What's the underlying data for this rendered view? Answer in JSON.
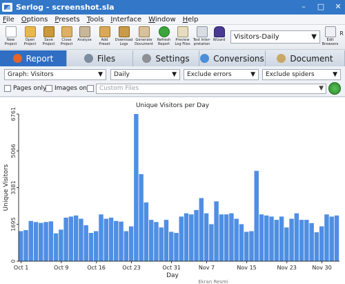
{
  "window": {
    "title": "Serlog - screenshot.sla",
    "controls": [
      "–",
      "□",
      "✕"
    ]
  },
  "menu": [
    {
      "label": "File",
      "access": "F",
      "rest": "ile"
    },
    {
      "label": "Options",
      "access": "O",
      "rest": "ptions"
    },
    {
      "label": "Presets",
      "access": "P",
      "rest": "resets"
    },
    {
      "label": "Tools",
      "access": "T",
      "rest": "ools"
    },
    {
      "label": "Interface",
      "access": "I",
      "rest": "nterface"
    },
    {
      "label": "Window",
      "access": "W",
      "rest": "indow"
    },
    {
      "label": "Help",
      "access": "H",
      "rest": "elp"
    }
  ],
  "toolbar": {
    "buttons": [
      {
        "line1": "New",
        "line2": "Project",
        "icon": "new-project-icon",
        "kind": "doc"
      },
      {
        "line1": "Open",
        "line2": "Project",
        "icon": "open-project-icon",
        "kind": "open"
      },
      {
        "line1": "Save",
        "line2": "Project",
        "icon": "save-project-icon",
        "kind": "save"
      },
      {
        "line1": "Close",
        "line2": "Project",
        "icon": "close-project-icon",
        "kind": "close"
      },
      {
        "line1": "Analyze",
        "line2": "",
        "icon": "analyze-icon",
        "kind": "analyze"
      },
      {
        "line1": "Add",
        "line2": "Preset",
        "icon": "add-preset-icon",
        "kind": "add"
      },
      {
        "line1": "Download",
        "line2": "Logs",
        "icon": "download-logs-icon",
        "kind": "download"
      },
      {
        "line1": "Generate",
        "line2": "Document",
        "icon": "generate-document-icon",
        "kind": "gen"
      },
      {
        "line1": "Refresh",
        "line2": "Report",
        "icon": "refresh-report-icon",
        "kind": "refresh"
      },
      {
        "line1": "Preview",
        "line2": "Log Files",
        "icon": "preview-log-files-icon",
        "kind": "preview"
      },
      {
        "line1": "Test Inter-",
        "line2": "pretation",
        "icon": "test-interpretation-icon",
        "kind": "test"
      },
      {
        "line1": "Wizard",
        "line2": "",
        "icon": "wizard-icon",
        "kind": "wizard"
      }
    ],
    "preset_value": "Visitors-Daily",
    "edit_button": {
      "line1": "Edit",
      "line2": "Browsers",
      "icon": "edit-browsers-icon"
    },
    "extra_label": "R"
  },
  "tabs": [
    {
      "label": "Report",
      "icon": "report-icon",
      "active": true,
      "color": "#e0662b"
    },
    {
      "label": "Files",
      "icon": "files-icon",
      "active": false,
      "color": "#7d8c9e"
    },
    {
      "label": "Settings",
      "icon": "settings-icon",
      "active": false,
      "color": "#8d9096"
    },
    {
      "label": "Conversions",
      "icon": "conversions-icon",
      "active": false,
      "color": "#4a8fd8"
    },
    {
      "label": "Document",
      "icon": "document-icon",
      "active": false,
      "color": "#c9a866"
    }
  ],
  "filters": {
    "graph": "Graph: Visitors",
    "period": "Daily",
    "errors": "Exclude errors",
    "spiders": "Exclude spiders",
    "pages_only": "Pages only",
    "images_only": "Images only",
    "custom_files_placeholder": "Custom Files"
  },
  "colors": {
    "accent": "#2f6ec3",
    "bar": "#4f8fe3"
  },
  "chart_data": {
    "type": "bar",
    "title": "Unique Visitors per Day",
    "xlabel": "Day",
    "ylabel": "Unique Visitors",
    "ylim": [
      0,
      6761
    ],
    "yticks": [
      0,
      1695,
      3381,
      5066,
      6761
    ],
    "xtick_labels": [
      "Oct 1",
      "Oct 9",
      "Oct 16",
      "Oct 23",
      "Oct 31",
      "Nov 7",
      "Nov 15",
      "Nov 23",
      "Nov 30"
    ],
    "xtick_indices": [
      1,
      9,
      16,
      23,
      31,
      38,
      46,
      54,
      61
    ],
    "grid": false,
    "values": [
      1380,
      1430,
      1850,
      1800,
      1760,
      1800,
      1830,
      1280,
      1450,
      2000,
      2050,
      2100,
      1950,
      1650,
      1300,
      1380,
      2150,
      1950,
      2000,
      1850,
      1820,
      1380,
      1600,
      6761,
      4000,
      2700,
      1900,
      1800,
      1550,
      1900,
      1350,
      1300,
      2050,
      2200,
      2150,
      2350,
      2900,
      2200,
      1700,
      2750,
      2150,
      2150,
      2200,
      1950,
      1700,
      1350,
      1380,
      4150,
      2150,
      2100,
      2050,
      1900,
      2050,
      1550,
      1950,
      2200,
      1900,
      1900,
      1750,
      1330,
      1600,
      2150,
      2050,
      2100
    ],
    "bottom_label": "Ekran Resmi"
  }
}
